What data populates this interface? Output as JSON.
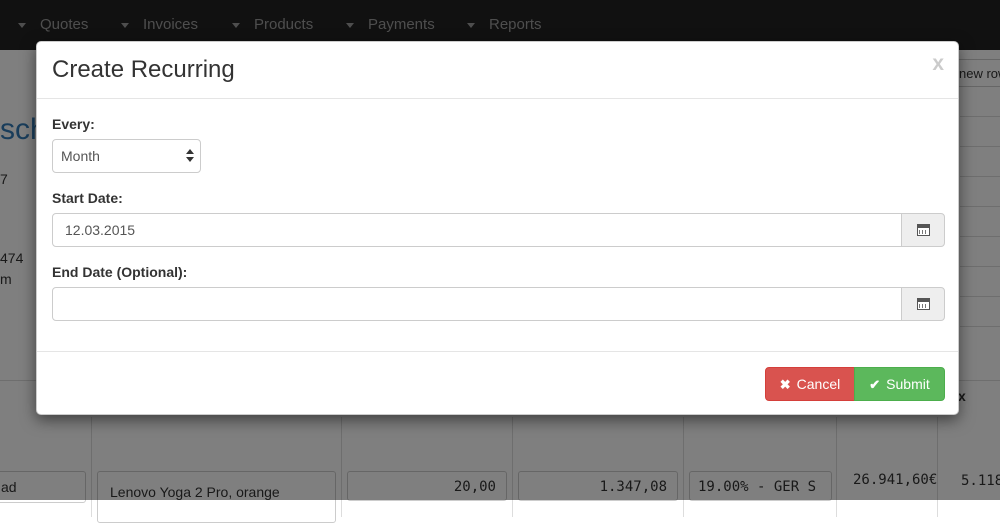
{
  "navbar": {
    "items": [
      {
        "label": "Quotes"
      },
      {
        "label": "Invoices"
      },
      {
        "label": "Products"
      },
      {
        "label": "Payments"
      },
      {
        "label": "Reports"
      }
    ]
  },
  "background": {
    "title_fragment": "sch",
    "new_row_button": "new row",
    "line1": "7",
    "line2": "474",
    "line3": "m",
    "row": {
      "item_code": "ad",
      "description": "Lenovo Yoga 2 Pro, orange",
      "quantity": "20,00",
      "price": "1.347,08",
      "tax": "19.00% - GER S",
      "total": "26.941,60€",
      "tax_header": "x",
      "tax_total": "5.118"
    }
  },
  "modal": {
    "title": "Create Recurring",
    "close_symbol": "x",
    "every_label": "Every:",
    "every_value": "Month",
    "start_label": "Start Date:",
    "start_value": "12.03.2015",
    "end_label": "End Date (Optional):",
    "end_value": "",
    "cancel_label": "Cancel",
    "submit_label": "Submit",
    "cancel_icon": "✖",
    "submit_icon": "✔"
  },
  "colors": {
    "navbar_bg": "#222222",
    "cancel": "#d9534f",
    "submit": "#5cb85c",
    "link": "#337ab7"
  }
}
